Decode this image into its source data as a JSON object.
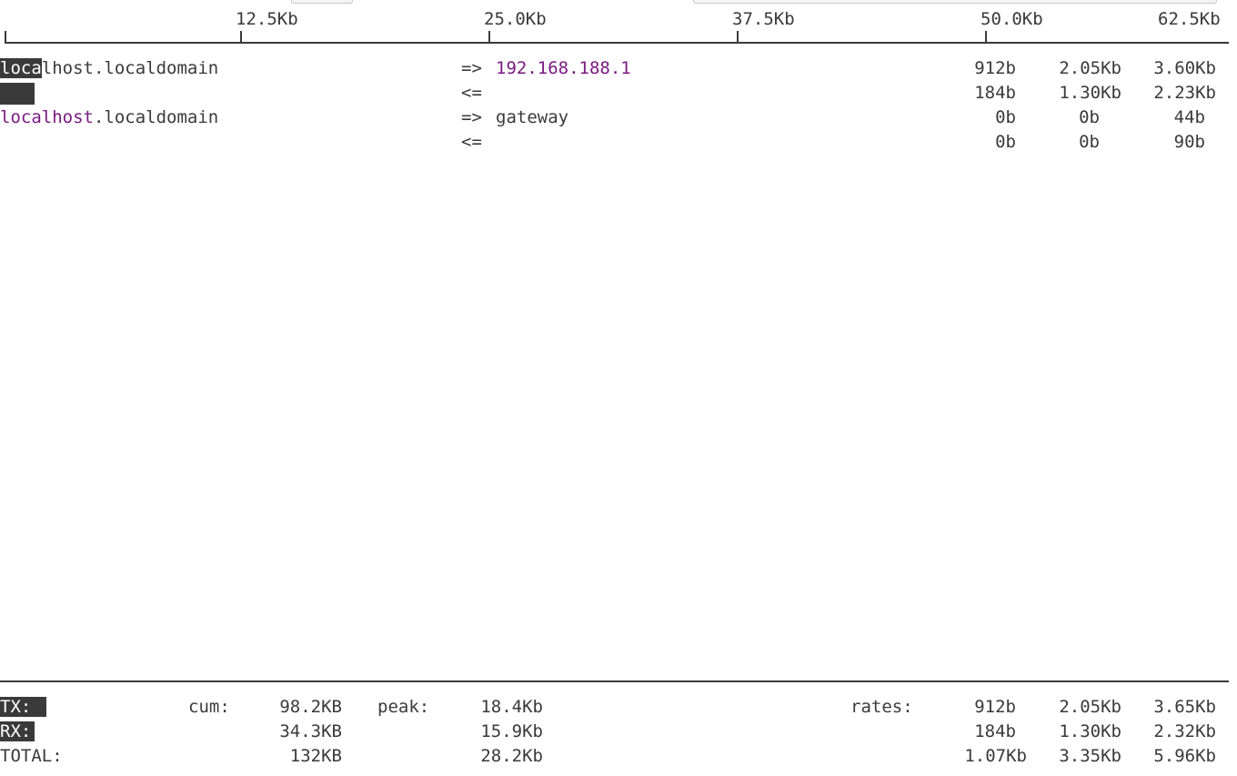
{
  "scale": {
    "ticks": [
      "12.5Kb",
      "25.0Kb",
      "37.5Kb",
      "50.0Kb",
      "62.5Kb"
    ]
  },
  "connections": [
    {
      "source_prefix": "loca",
      "source_rest": "lhost.localdomain",
      "out_arrow": "=>",
      "in_arrow": "<=",
      "dest": "192.168.188.1",
      "out_rates": [
        "912b",
        "2.05Kb",
        "3.60Kb"
      ],
      "in_rates": [
        "184b",
        "1.30Kb",
        "2.23Kb"
      ]
    },
    {
      "source_purple": "localhost",
      "source_rest": ".localdomain",
      "out_arrow": "=>",
      "in_arrow": "<=",
      "dest": "gateway",
      "out_rates": [
        "0b",
        "0b",
        "44b"
      ],
      "in_rates": [
        "0b",
        "0b",
        "90b"
      ]
    }
  ],
  "totals": {
    "tx_label": "TX:",
    "rx_label": "RX:",
    "total_label": "TOTAL:",
    "cum_label": "cum:",
    "peak_label": "peak:",
    "rates_label": "rates:",
    "tx": {
      "cum": "98.2KB",
      "peak": "18.4Kb",
      "rates": [
        "912b",
        "2.05Kb",
        "3.65Kb"
      ]
    },
    "rx": {
      "cum": "34.3KB",
      "peak": "15.9Kb",
      "rates": [
        "184b",
        "1.30Kb",
        "2.32Kb"
      ]
    },
    "total": {
      "cum": "132KB",
      "peak": "28.2Kb",
      "rates": [
        "1.07Kb",
        "3.35Kb",
        "5.96Kb"
      ]
    }
  },
  "colors": {
    "text": "#3a3a3a",
    "host_highlight": "#7a1a82",
    "selection_bg": "#3a3a3a"
  }
}
